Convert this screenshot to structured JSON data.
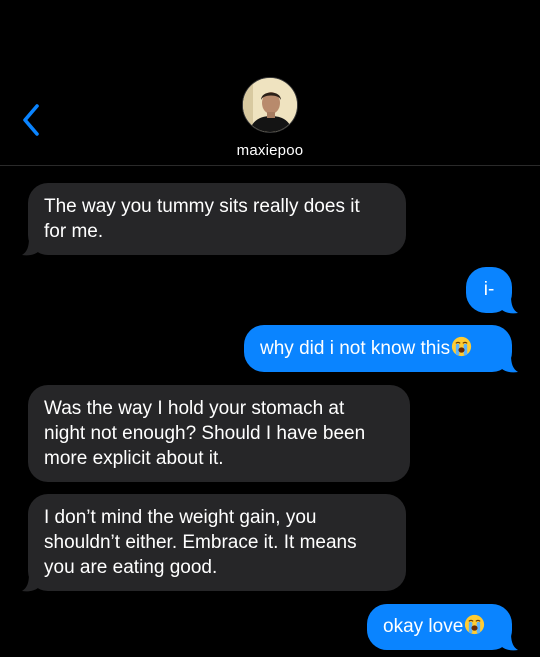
{
  "header": {
    "contact_name": "maxiepoo",
    "back_icon": "chevron-left-icon",
    "accent_color": "#0a84ff"
  },
  "messages": [
    {
      "direction": "incoming",
      "lines": [
        "The way you tummy sits really does it",
        "for me."
      ]
    },
    {
      "direction": "outgoing",
      "lines": [
        "i-"
      ]
    },
    {
      "direction": "outgoing",
      "lines": [
        "why did i not know this"
      ],
      "emoji": "loudly-crying-face-icon"
    },
    {
      "direction": "incoming",
      "lines": [
        "Was the way I hold your stomach at",
        "night not enough? Should I have been",
        "more explicit about it."
      ]
    },
    {
      "direction": "incoming",
      "lines": [
        "I don’t mind the weight gain, you",
        "shouldn’t either. Embrace it. It means",
        "you are eating good."
      ]
    },
    {
      "direction": "outgoing",
      "lines": [
        "okay love"
      ],
      "emoji": "loudly-crying-face-icon"
    }
  ],
  "colors": {
    "incoming_bubble": "#262628",
    "outgoing_bubble": "#0a84ff",
    "background": "#000000"
  }
}
